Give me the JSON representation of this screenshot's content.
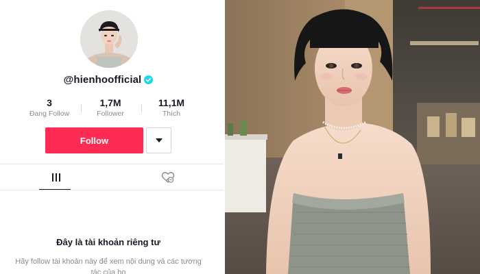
{
  "profile": {
    "username": "@hienhoofficial",
    "verified": true,
    "avatar": "profile-photo",
    "stats": [
      {
        "value": "3",
        "label": "Đang Follow"
      },
      {
        "value": "1,7M",
        "label": "Follower"
      },
      {
        "value": "11,1M",
        "label": "Thích"
      }
    ],
    "follow_label": "Follow",
    "more_icon": "caret-down-icon",
    "tabs": [
      {
        "icon": "grid-icon",
        "active": true
      },
      {
        "icon": "liked-heart-icon",
        "active": false
      }
    ],
    "private_title": "Đây là tài khoản riêng tư",
    "private_desc": "Hãy follow tài khoản này để xem nội dung và các tương tác của họ"
  },
  "colors": {
    "follow_button": "#fe2c55",
    "verified_badge": "#20d5ec",
    "text_primary": "#161823",
    "text_secondary": "#8a8b91"
  }
}
